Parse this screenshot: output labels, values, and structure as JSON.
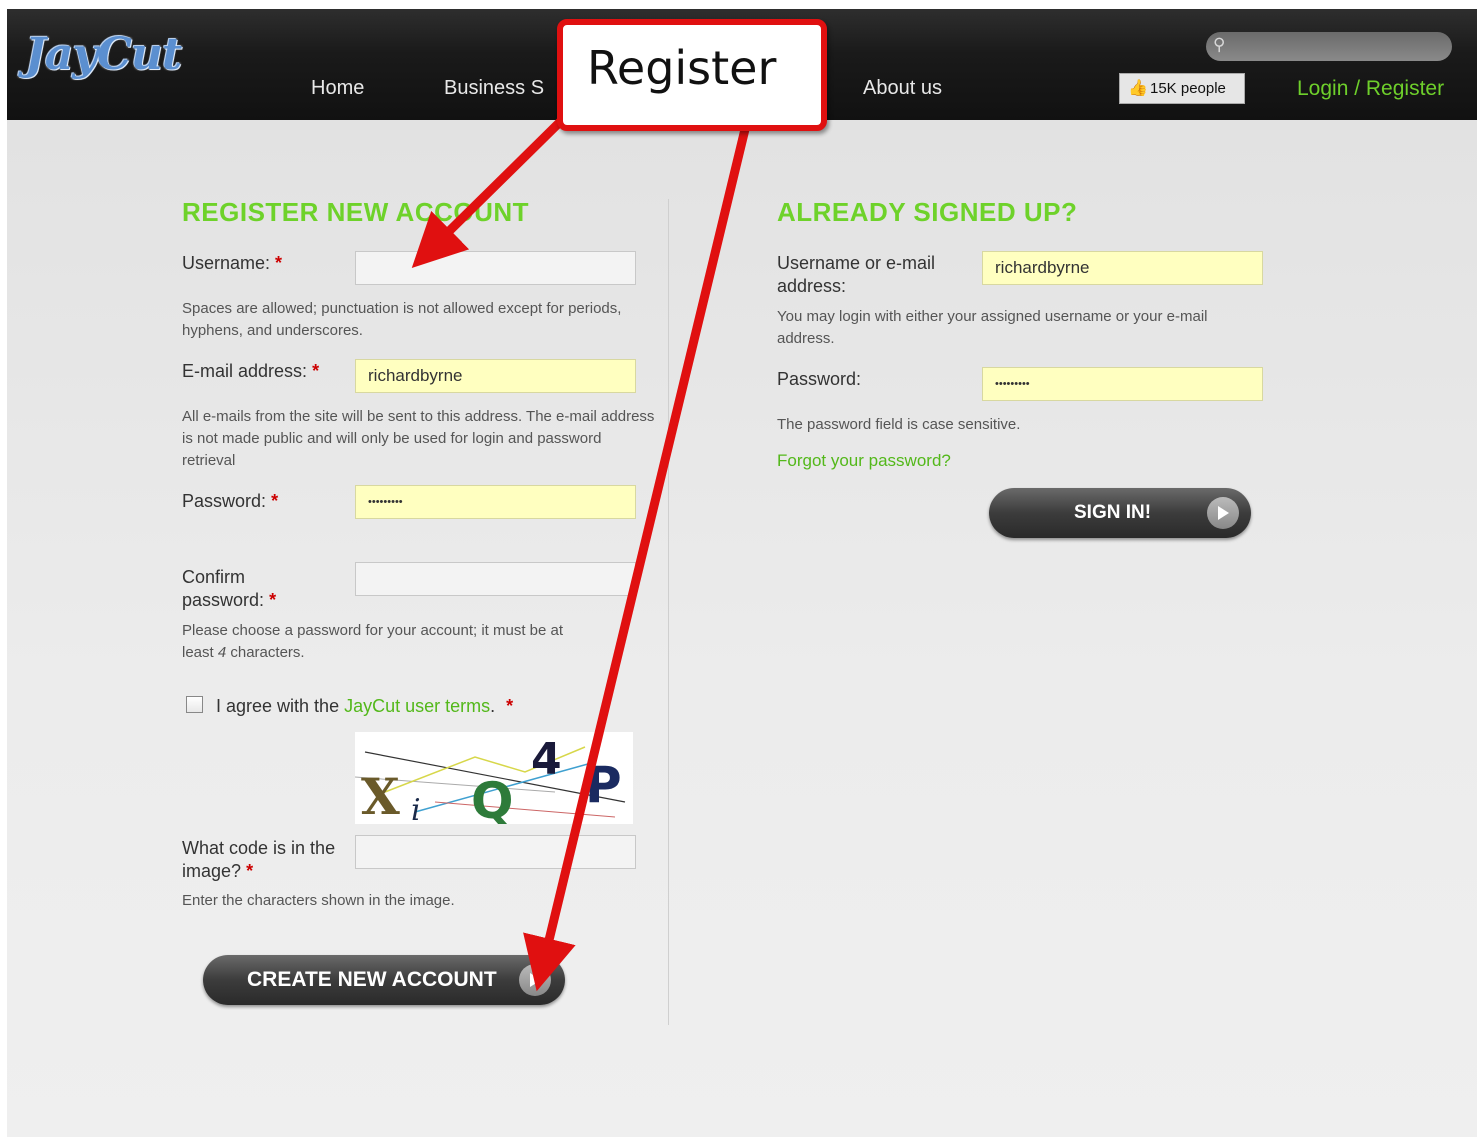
{
  "header": {
    "logo": "JayCut",
    "nav": [
      "Home",
      "Business S",
      "About us"
    ],
    "like_count": "15K people",
    "login_link": "Login / Register"
  },
  "callout": {
    "text": "Register"
  },
  "register": {
    "heading": "REGISTER NEW ACCOUNT",
    "username_label": "Username:",
    "username_hint": "Spaces are allowed; punctuation is not allowed except for periods, hyphens, and underscores.",
    "email_label": "E-mail address:",
    "email_value": "richardbyrne",
    "email_hint": "All e-mails from the site will be sent to this address. The e-mail address is not made public and will only be used for login and password retrieval",
    "password_label": "Password:",
    "password_value": "•••••••••",
    "confirm_label_1": "Confirm",
    "confirm_label_2": "password:",
    "confirm_hint_1": "Please choose a password for your account; it must be at",
    "confirm_hint_2": "least",
    "confirm_hint_num": "4",
    "confirm_hint_3": "characters.",
    "terms_prefix": "I agree with the",
    "terms_link": "JayCut user terms",
    "terms_suffix": ".",
    "captcha_chars": [
      "X",
      "i",
      "Q",
      "4",
      "P"
    ],
    "captcha_label_1": "What code is in the",
    "captcha_label_2": "image?",
    "captcha_hint": "Enter the characters shown in the image.",
    "submit": "CREATE NEW ACCOUNT",
    "required_mark": "*"
  },
  "signin": {
    "heading": "ALREADY SIGNED UP?",
    "username_label_1": "Username or e-mail",
    "username_label_2": "address:",
    "username_value": "richardbyrne",
    "username_hint": "You may login with either your assigned username or your e-mail address.",
    "password_label": "Password:",
    "password_value": "•••••••••",
    "password_hint": "The password field is case sensitive.",
    "forgot": "Forgot your password?",
    "submit": "SIGN IN!"
  }
}
